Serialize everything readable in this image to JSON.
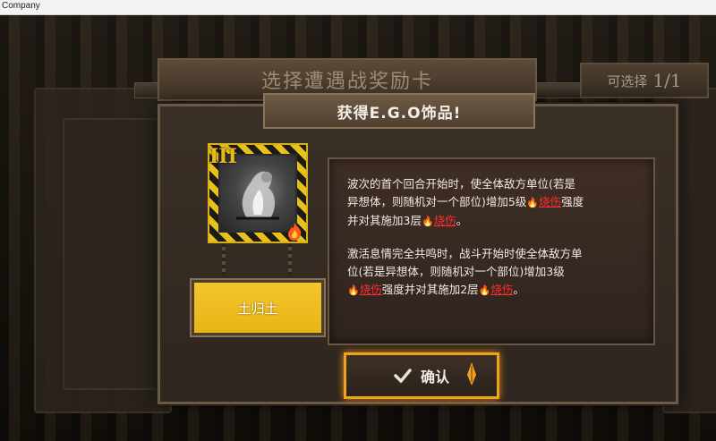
{
  "window": {
    "title": "Company"
  },
  "background": {
    "header": "选择遭遇战奖励卡",
    "select_label": "可选择",
    "select_count": "1/1"
  },
  "dialog": {
    "title": "获得E.G.O饰品!",
    "card": {
      "tier": "III",
      "name": "土归土",
      "icon": "flame-icon"
    },
    "description": {
      "p1_a": "波次的首个回合开始时，使全体敌方单位(若是",
      "p1_b": "异想体，则随机对一个部位)增加5级",
      "p1_c": "强度",
      "p1_d": "并对其施加3层",
      "p1_e": "。",
      "p2_a": "激活息情完全共鸣时，战斗开始时使全体敌方单",
      "p2_b": "位(若是异想体，则随机对一个部位)增加3级",
      "p2_c": "强度并对其施加2层",
      "p2_d": "。",
      "keyword": "烧伤"
    },
    "confirm_label": "确认"
  },
  "colors": {
    "accent": "#f0a21f",
    "burn": "#ff2d2d",
    "plate": "#f4c62d"
  }
}
